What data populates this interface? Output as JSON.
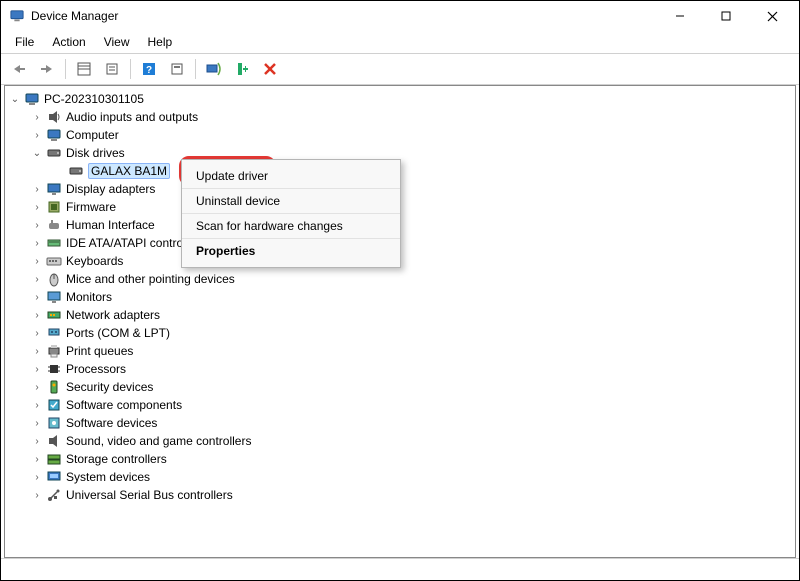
{
  "title": "Device Manager",
  "menus": [
    "File",
    "Action",
    "View",
    "Help"
  ],
  "root_node": "PC-202310301105",
  "categories": [
    {
      "label": "Audio inputs and outputs",
      "icon": "audio"
    },
    {
      "label": "Computer",
      "icon": "computer"
    },
    {
      "label": "Disk drives",
      "icon": "disk",
      "expanded": true,
      "children": [
        {
          "label": "GALAX BA1M",
          "icon": "disk",
          "selected": true
        }
      ]
    },
    {
      "label": "Display adapters",
      "icon": "display"
    },
    {
      "label": "Firmware",
      "icon": "firmware"
    },
    {
      "label": "Human Interface",
      "icon": "hid"
    },
    {
      "label": "IDE ATA/ATAPI controllers",
      "icon": "ide"
    },
    {
      "label": "Keyboards",
      "icon": "keyboard"
    },
    {
      "label": "Mice and other pointing devices",
      "icon": "mouse"
    },
    {
      "label": "Monitors",
      "icon": "monitor"
    },
    {
      "label": "Network adapters",
      "icon": "network"
    },
    {
      "label": "Ports (COM & LPT)",
      "icon": "ports"
    },
    {
      "label": "Print queues",
      "icon": "printer"
    },
    {
      "label": "Processors",
      "icon": "cpu"
    },
    {
      "label": "Security devices",
      "icon": "security"
    },
    {
      "label": "Software components",
      "icon": "softcomp"
    },
    {
      "label": "Software devices",
      "icon": "softdev"
    },
    {
      "label": "Sound, video and game controllers",
      "icon": "sound"
    },
    {
      "label": "Storage controllers",
      "icon": "storage"
    },
    {
      "label": "System devices",
      "icon": "system"
    },
    {
      "label": "Universal Serial Bus controllers",
      "icon": "usb"
    }
  ],
  "context_menu": {
    "items": [
      {
        "label": "Update driver",
        "highlighted": true
      },
      {
        "label": "Uninstall device"
      },
      {
        "label": "Scan for hardware changes"
      },
      {
        "label": "Properties",
        "strong": true
      }
    ]
  }
}
